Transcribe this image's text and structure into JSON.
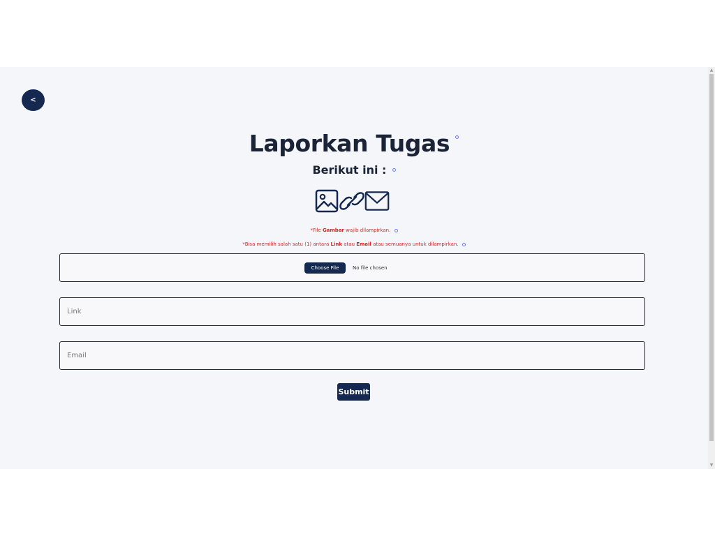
{
  "header": {
    "back_label": "<"
  },
  "main": {
    "title": "Laporkan Tugas",
    "subtitle": "Berikut ini :",
    "icons": [
      "image-icon",
      "link-icon",
      "mail-icon"
    ],
    "notes": {
      "note1": {
        "prefix": "*File ",
        "highlight": "Gambar",
        "suffix": " wajib dilampirkan."
      },
      "note2": {
        "prefix": "*Bisa memilih salah satu (1) antara ",
        "link": "Link",
        "middle": " atau ",
        "email": "Email",
        "suffix": " atau semuanya untuk dilampirkan."
      }
    }
  },
  "form": {
    "file": {
      "button_label": "Choose File",
      "status": "No file chosen"
    },
    "link": {
      "value": "",
      "placeholder": "Link"
    },
    "email": {
      "value": "",
      "placeholder": "Email"
    },
    "submit_label": "Submit"
  },
  "colors": {
    "primary": "#142850",
    "text": "#1b2437",
    "note": "#cc2b2b",
    "background": "#f5f6fa"
  }
}
